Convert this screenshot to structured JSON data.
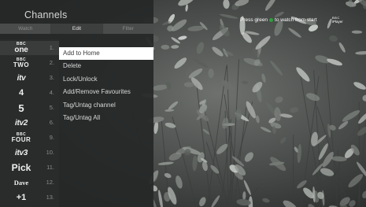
{
  "panel": {
    "title": "Channels",
    "tabs": [
      {
        "label": "Watch",
        "active": false
      },
      {
        "label": "Edit",
        "active": true
      },
      {
        "label": "Filter",
        "active": false
      }
    ]
  },
  "channels": [
    {
      "logo_top": "BBC",
      "logo_main": "one",
      "number": "1."
    },
    {
      "logo_top": "BBC",
      "logo_main": "TWO",
      "number": "2."
    },
    {
      "logo_top": "",
      "logo_main": "itv",
      "number": "3."
    },
    {
      "logo_top": "",
      "logo_main": "4",
      "number": "4."
    },
    {
      "logo_top": "",
      "logo_main": "5",
      "number": "5."
    },
    {
      "logo_top": "",
      "logo_main": "itv2",
      "number": "6."
    },
    {
      "logo_top": "BBC",
      "logo_main": "FOUR",
      "number": "9."
    },
    {
      "logo_top": "",
      "logo_main": "itv3",
      "number": "10."
    },
    {
      "logo_top": "",
      "logo_main": "Pick",
      "number": "11."
    },
    {
      "logo_top": "",
      "logo_main": "Dave",
      "number": "12."
    },
    {
      "logo_top": "",
      "logo_main": "+1",
      "number": "13."
    }
  ],
  "menu": {
    "items": [
      "Add to Home",
      "Delete",
      "Lock/Unlock",
      "Add/Remove Favourites",
      "Tag/Untag channel",
      "Tag/Untag All"
    ],
    "highlighted_index": 0
  },
  "hint": {
    "before": "Press green",
    "after": "to watch from start",
    "green_color": "#2e9f3c"
  },
  "iplayer": {
    "top": "BBC",
    "bottom": "iPlayer"
  },
  "colors": {
    "panel_bg": "#262828",
    "highlight_bg": "#ffffff",
    "text": "#d8d8d8"
  }
}
